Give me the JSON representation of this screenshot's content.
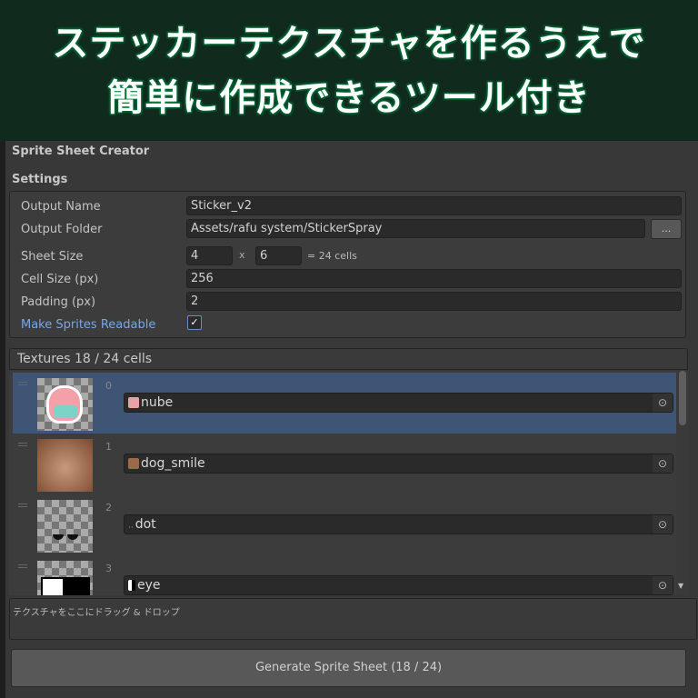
{
  "banner": {
    "line1": "ステッカーテクスチャを作るうえで",
    "line2": "簡単に作成できるツール付き"
  },
  "window": {
    "title": "Sprite Sheet Creator"
  },
  "settings": {
    "heading": "Settings",
    "output_name_label": "Output Name",
    "output_name": "Sticker_v2",
    "output_folder_label": "Output Folder",
    "output_folder": "Assets/rafu system/StickerSpray",
    "browse_label": "...",
    "sheet_size_label": "Sheet Size",
    "cols": "4",
    "times": "x",
    "rows": "6",
    "cells_text": "= 24 cells",
    "cell_size_label": "Cell Size (px)",
    "cell_size": "256",
    "padding_label": "Padding (px)",
    "padding": "2",
    "readable_label": "Make Sprites Readable",
    "readable_checked": true,
    "check": "✓"
  },
  "textures": {
    "header": "Textures  18 / 24  cells",
    "items": [
      {
        "index": "0",
        "name": "nube"
      },
      {
        "index": "1",
        "name": "dog_smile"
      },
      {
        "index": "2",
        "name": "dot"
      },
      {
        "index": "3",
        "name": "eye"
      }
    ],
    "selected_color": "#3e5576"
  },
  "drop_hint": "テクスチャをここにドラッグ & ドロップ",
  "generate_label": "Generate Sprite Sheet  (18 / 24)"
}
